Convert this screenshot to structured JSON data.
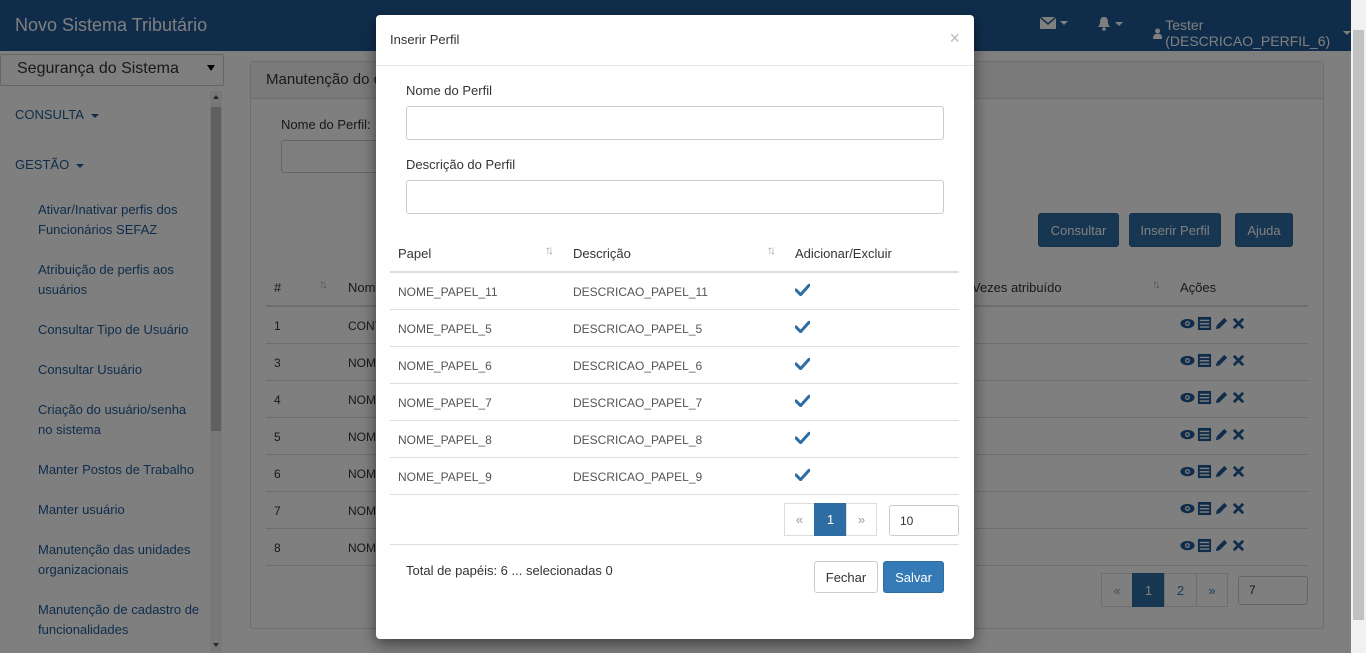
{
  "navbar": {
    "brand": "Novo Sistema Tributário",
    "user": "Tester (DESCRICAO_PERFIL_6)"
  },
  "sidebar": {
    "select_value": "Segurança do Sistema",
    "menus": [
      "CONSULTA",
      "GESTÃO"
    ],
    "items": [
      "Ativar/Inativar perfis dos Funcionários SEFAZ",
      "Atribuição de perfis aos usuários",
      "Consultar Tipo de Usuário",
      "Consultar Usuário",
      "Criação do usuário/senha no sistema",
      "Manter Postos de Trabalho",
      "Manter usuário",
      "Manutenção das unidades organizacionais",
      "Manutenção de cadastro de funcionalidades"
    ]
  },
  "main": {
    "panel_title": "Manutenção do c",
    "nome_label": "Nome do Perfil:",
    "buttons": {
      "consultar": "Consultar",
      "inserir": "Inserir Perfil",
      "ajuda": "Ajuda"
    },
    "columns": {
      "num": "#",
      "nome": "Nom",
      "vezes": "Vezes atribuído",
      "acoes": "Ações"
    },
    "rows": [
      {
        "num": "1",
        "nome": "CONT"
      },
      {
        "num": "3",
        "nome": "NOM"
      },
      {
        "num": "4",
        "nome": "NOM"
      },
      {
        "num": "5",
        "nome": "NOM"
      },
      {
        "num": "6",
        "nome": "NOM"
      },
      {
        "num": "7",
        "nome": "NOM"
      },
      {
        "num": "8",
        "nome": "NOM"
      }
    ],
    "pager": {
      "prev": "«",
      "pages": [
        "1",
        "2"
      ],
      "next": "»",
      "size": "7"
    }
  },
  "modal": {
    "title": "Inserir Perfil",
    "close": "×",
    "nome_label": "Nome do Perfil",
    "nome_value": "",
    "descricao_label": "Descrição do Perfil",
    "descricao_value": "",
    "columns": {
      "papel": "Papel",
      "descricao": "Descrição",
      "acao": "Adicionar/Excluir"
    },
    "rows": [
      {
        "papel": "NOME_PAPEL_11",
        "descricao": "DESCRICAO_PAPEL_11",
        "selected": true
      },
      {
        "papel": "NOME_PAPEL_5",
        "descricao": "DESCRICAO_PAPEL_5",
        "selected": true
      },
      {
        "papel": "NOME_PAPEL_6",
        "descricao": "DESCRICAO_PAPEL_6",
        "selected": true
      },
      {
        "papel": "NOME_PAPEL_7",
        "descricao": "DESCRICAO_PAPEL_7",
        "selected": true
      },
      {
        "papel": "NOME_PAPEL_8",
        "descricao": "DESCRICAO_PAPEL_8",
        "selected": true
      },
      {
        "papel": "NOME_PAPEL_9",
        "descricao": "DESCRICAO_PAPEL_9",
        "selected": true
      }
    ],
    "pager": {
      "prev": "«",
      "page": "1",
      "next": "»",
      "size": "10"
    },
    "total": "Total de papéis: 6 ... selecionadas 0",
    "fechar": "Fechar",
    "salvar": "Salvar"
  },
  "colors": {
    "navbar": "#1e5a96",
    "primary": "#337ab7",
    "check": "#2e6da4"
  }
}
